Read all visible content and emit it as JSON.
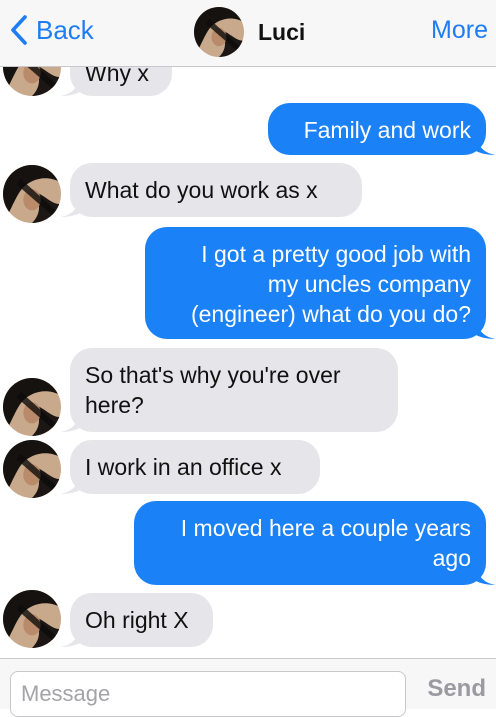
{
  "nav": {
    "back_label": "Back",
    "title": "Luci",
    "more_label": "More"
  },
  "messages": [
    {
      "from": "them",
      "lines": [
        "Why x"
      ]
    },
    {
      "from": "me",
      "lines": [
        "Family and work"
      ]
    },
    {
      "from": "them",
      "lines": [
        "What do you work as x"
      ]
    },
    {
      "from": "me",
      "lines": [
        "I got a pretty good job with",
        "my uncles company",
        "(engineer) what do you do?"
      ]
    },
    {
      "from": "them",
      "lines": [
        "So that's why you're over",
        "here?"
      ]
    },
    {
      "from": "them",
      "lines": [
        "I work in an office x"
      ]
    },
    {
      "from": "me",
      "lines": [
        "I moved here a couple years",
        "ago"
      ]
    },
    {
      "from": "them",
      "lines": [
        "Oh right X"
      ]
    }
  ],
  "input": {
    "placeholder": "Message",
    "value": "",
    "send_label": "Send"
  },
  "colors": {
    "accent": "#1e7cf5",
    "outgoing_bubble": "#1a81f7",
    "incoming_bubble": "#e5e5ea"
  }
}
